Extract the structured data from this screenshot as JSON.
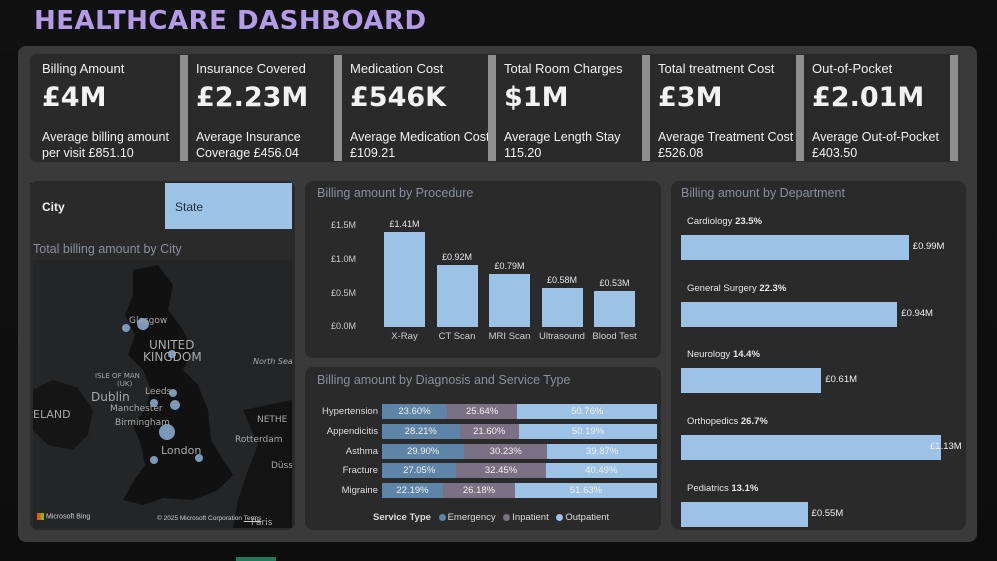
{
  "title": "HEALTHCARE DASHBOARD",
  "kpis": [
    {
      "label": "Billing Amount",
      "value": "£4M",
      "sub": "Average billing amount per visit £851.10"
    },
    {
      "label": "Insurance Covered",
      "value": "£2.23M",
      "sub": "Average Insurance Coverage £456.04"
    },
    {
      "label": "Medication Cost",
      "value": "£546K",
      "sub": "Average Medication Cost £109.21"
    },
    {
      "label": "Total Room Charges",
      "value": "$1M",
      "sub": "Average Length Stay 115.20"
    },
    {
      "label": "Total treatment Cost",
      "value": "£3M",
      "sub": "Average Treatment Cost £526.08"
    },
    {
      "label": "Out-of-Pocket",
      "value": "£2.01M",
      "sub": "Average Out-of-Pocket £403.50"
    }
  ],
  "slicer": {
    "tab_city": "City",
    "tab_state": "State",
    "active": "State"
  },
  "map": {
    "title": "Total billing amount by City",
    "labels": {
      "glasgow": "Glasgow",
      "united": "UNITED",
      "kingdom": "KINGDOM",
      "isle": "ISLE OF MAN",
      "uk": "(UK)",
      "leeds": "Leeds",
      "dublin": "Dublin",
      "manchester": "Manchester",
      "birmingham": "Birmingham",
      "ireland": "ELAND",
      "netherlands": "NETHE",
      "rotterdam": "Rotterdam",
      "london": "London",
      "dusseldorf": "Düss",
      "north_sea": "North Sea",
      "paris": "Paris"
    },
    "attribution": "Microsoft Bing",
    "copyright": "© 2025 Microsoft Corporation",
    "terms": "Terms"
  },
  "procedure": {
    "title": "Billing amount by Procedure",
    "y_ticks": [
      "£1.5M",
      "£1.0M",
      "£0.5M",
      "£0.0M"
    ],
    "bars": [
      {
        "label": "X-Ray",
        "value": 1.41,
        "text": "£1.41M"
      },
      {
        "label": "CT Scan",
        "value": 0.92,
        "text": "£0.92M"
      },
      {
        "label": "MRI Scan",
        "value": 0.79,
        "text": "£0.79M"
      },
      {
        "label": "Ultrasound",
        "value": 0.58,
        "text": "£0.58M"
      },
      {
        "label": "Blood Test",
        "value": 0.53,
        "text": "£0.53M"
      }
    ]
  },
  "diagnosis": {
    "title": "Billing amount by Diagnosis and Service Type",
    "legend_title": "Service Type",
    "legend": [
      "Emergency",
      "Inpatient",
      "Outpatient"
    ],
    "colors": [
      "#5e84a8",
      "#7a7185",
      "#9cc2e5"
    ],
    "rows": [
      {
        "name": "Hypertension",
        "values": [
          23.6,
          25.64,
          50.76
        ],
        "texts": [
          "23.60%",
          "25.64%",
          "50.76%"
        ]
      },
      {
        "name": "Appendicitis",
        "values": [
          28.21,
          21.6,
          50.19
        ],
        "texts": [
          "28.21%",
          "21.60%",
          "50.19%"
        ]
      },
      {
        "name": "Asthma",
        "values": [
          29.9,
          30.23,
          39.87
        ],
        "texts": [
          "29.90%",
          "30.23%",
          "39.87%"
        ]
      },
      {
        "name": "Fracture",
        "values": [
          27.05,
          32.45,
          40.49
        ],
        "texts": [
          "27.05%",
          "32.45%",
          "40.49%"
        ]
      },
      {
        "name": "Migraine",
        "values": [
          22.19,
          26.18,
          51.63
        ],
        "texts": [
          "22.19%",
          "26.18%",
          "51.63%"
        ]
      }
    ]
  },
  "department": {
    "title": "Billing amount by Department",
    "items": [
      {
        "name": "Cardiology",
        "pct": "23.5%",
        "value": 0.99,
        "text": "£0.99M"
      },
      {
        "name": "General Surgery",
        "pct": "22.3%",
        "value": 0.94,
        "text": "£0.94M"
      },
      {
        "name": "Neurology",
        "pct": "14.4%",
        "value": 0.61,
        "text": "£0.61M"
      },
      {
        "name": "Orthopedics",
        "pct": "26.7%",
        "value": 1.13,
        "text": "£1.13M"
      },
      {
        "name": "Pediatrics",
        "pct": "13.1%",
        "value": 0.55,
        "text": "£0.55M"
      }
    ]
  }
}
